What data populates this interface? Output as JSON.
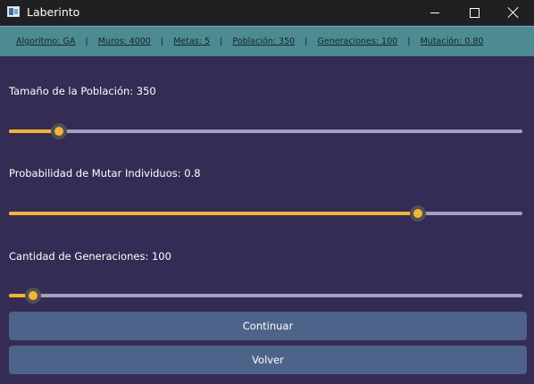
{
  "window": {
    "title": "Laberinto",
    "icon": "app-window-icon"
  },
  "infobar": {
    "items": [
      {
        "label": "Algoritmo: GA"
      },
      {
        "label": "Muros: 4000"
      },
      {
        "label": "Metas: 5"
      },
      {
        "label": "Población: 350"
      },
      {
        "label": "Generaciones: 100"
      },
      {
        "label": "Mutación: 0.80"
      }
    ],
    "separator": "|"
  },
  "sliders": [
    {
      "label": "Tamaño de la Población: 350",
      "fraction": 0.097
    },
    {
      "label": "Probabilidad de Mutar Individuos: 0.8",
      "fraction": 0.797
    },
    {
      "label": "Cantidad de Generaciones: 100",
      "fraction": 0.047
    }
  ],
  "buttons": {
    "continue": "Continuar",
    "back": "Volver"
  },
  "colors": {
    "background": "#342c54",
    "infobar": "#4e8a92",
    "accent": "#f2b53a",
    "track": "#a59fc0",
    "button": "#4e6389"
  }
}
